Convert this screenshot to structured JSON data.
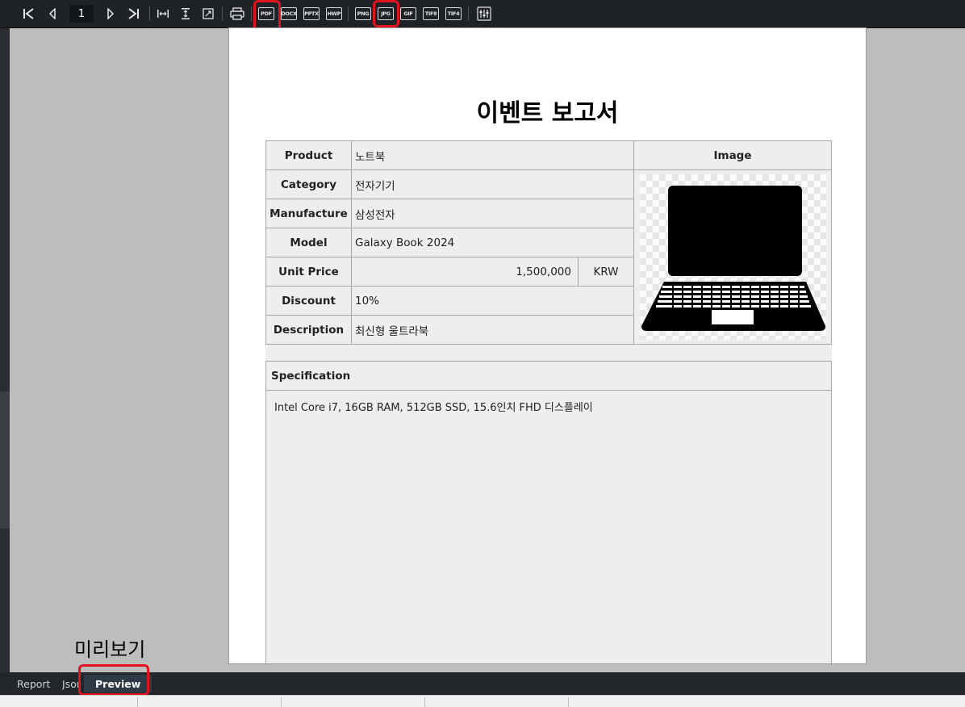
{
  "toolbar": {
    "page_number": "1",
    "navigation": [
      {
        "name": "first-page-icon",
        "glyph": "I◀"
      },
      {
        "name": "prev-page-icon",
        "glyph": "◁"
      },
      {
        "name": "next-page-icon",
        "glyph": "▷"
      },
      {
        "name": "last-page-icon",
        "glyph": "▷I"
      }
    ],
    "view_icons": [
      "fit-width-icon",
      "fit-height-icon",
      "fit-page-icon"
    ],
    "print_icon": "printer-icon",
    "export_formats": [
      "PDF",
      "DOCX",
      "PPTX",
      "HWP",
      "PNG",
      "JPG",
      "GIF",
      "TIF8",
      "TIF4"
    ],
    "settings_icon": "settings-sliders-icon",
    "highlighted_formats": [
      "PDF",
      "JPG"
    ],
    "highlight_color": "#e0141e"
  },
  "report": {
    "title": "이벤트 보고서",
    "fields": [
      {
        "label": "Product",
        "value": "노트북"
      },
      {
        "label": "Category",
        "value": "전자기기"
      },
      {
        "label": "Manufacture",
        "value": "삼성전자"
      },
      {
        "label": "Model",
        "value": "Galaxy Book 2024"
      },
      {
        "label": "Unit Price",
        "value": "1,500,000",
        "currency": "KRW"
      },
      {
        "label": "Discount",
        "value": "10%"
      },
      {
        "label": "Description",
        "value": "최신형 울트라북"
      }
    ],
    "image_header": "Image",
    "image_icon": "laptop-icon",
    "spec_header": "Specification",
    "spec_text": "Intel Core i7, 16GB RAM, 512GB SSD, 15.6인치 FHD 디스플레이"
  },
  "annotation": "미리보기",
  "tabs": [
    {
      "label": "Report",
      "active": false
    },
    {
      "label": "Json",
      "active": false
    },
    {
      "label": "Preview",
      "active": true
    }
  ]
}
